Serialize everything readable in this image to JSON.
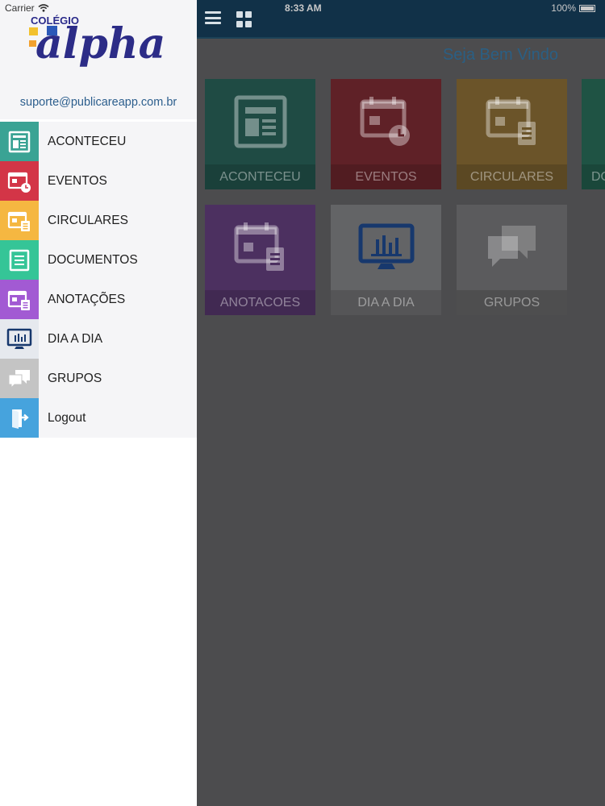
{
  "status": {
    "carrier": "Carrier",
    "time": "8:33 AM",
    "battery": "100%"
  },
  "brand": {
    "logo_top": "COLÉGIO",
    "logo_main": "alpha",
    "email": "suporte@publicareapp.com.br"
  },
  "menu": [
    {
      "label": "ACONTECEU",
      "color": "#3aa394",
      "icon": "newspaper-icon"
    },
    {
      "label": "EVENTOS",
      "color": "#d33547",
      "icon": "calendar-clock-icon"
    },
    {
      "label": "CIRCULARES",
      "color": "#f5b741",
      "icon": "calendar-document-icon"
    },
    {
      "label": "DOCUMENTOS",
      "color": "#35c597",
      "icon": "document-icon"
    },
    {
      "label": "ANOTAÇÕES",
      "color": "#a25ad3",
      "icon": "calendar-note-icon"
    },
    {
      "label": "DIA A DIA",
      "color": "#e6e9ee",
      "icon": "monitor-chart-icon"
    },
    {
      "label": "GRUPOS",
      "color": "#c4c4c4",
      "icon": "chat-icon"
    },
    {
      "label": "Logout",
      "color": "#46a3dd",
      "icon": "logout-icon"
    }
  ],
  "main": {
    "welcome": "Seja Bem Vindo",
    "tiles": [
      {
        "label": "ACONTECEU",
        "color": "#1f4b44",
        "icon": "newspaper-icon"
      },
      {
        "label": "EVENTOS",
        "color": "#5f2127",
        "icon": "calendar-clock-icon"
      },
      {
        "label": "CIRCULARES",
        "color": "#6b5429",
        "icon": "calendar-document-icon"
      },
      {
        "label": "DO",
        "color": "#1f5344",
        "icon": "document-icon"
      },
      {
        "label": "ANOTACOES",
        "color": "#4c3060",
        "icon": "calendar-note-icon"
      },
      {
        "label": "DIA A DIA",
        "color": "#636466",
        "icon": "monitor-chart-icon"
      },
      {
        "label": "GRUPOS",
        "color": "#5b5b5d",
        "icon": "chat-icon"
      }
    ]
  }
}
